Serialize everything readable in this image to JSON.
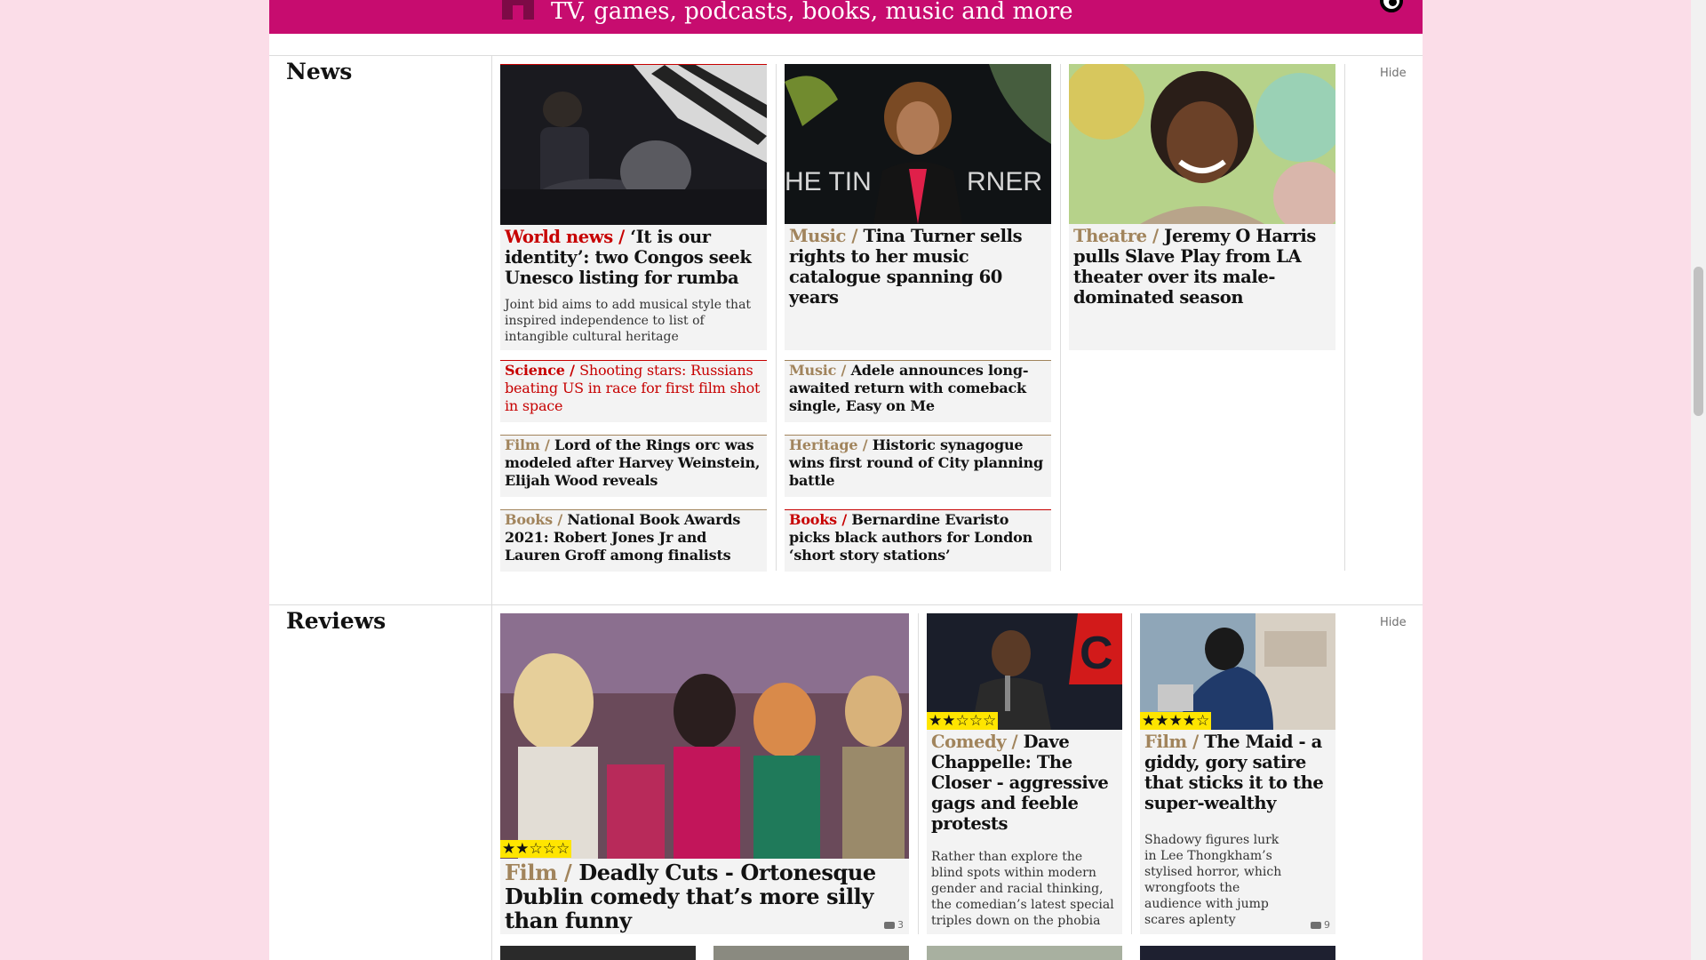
{
  "banner": {
    "text": "TV, games, podcasts, books, music and more",
    "icon": "guardian-icon",
    "logo": "guardian-logo-icon"
  },
  "news": {
    "title": "News",
    "hide_label": "Hide",
    "featured": [
      {
        "kicker": "World news /",
        "headline": "‘It is our identity’: two Congos seek Unesco listing for rumba",
        "standfirst": "Joint bid aims to add musical style that inspired independence to list of intangible cultural heritage",
        "image": "rumba-musicians-photo"
      },
      {
        "kicker": "Music /",
        "headline": "Tina Turner sells rights to her music catalogue spanning 60 years",
        "image": "tina-turner-photo"
      },
      {
        "kicker": "Theatre /",
        "headline": "Jeremy O Harris pulls Slave Play from LA theater over its male-dominated season",
        "image": "jeremy-o-harris-photo"
      }
    ],
    "small": [
      {
        "kicker": "Science /",
        "headline": "Shooting stars: Russians beating US in race for first film shot in space"
      },
      {
        "kicker": "Music /",
        "headline": "Adele announces long-awaited return with comeback single, Easy on Me"
      },
      {
        "kicker": "Film /",
        "headline": "Lord of the Rings orc was modeled after Harvey Weinstein, Elijah Wood reveals"
      },
      {
        "kicker": "Heritage /",
        "headline": "Historic synagogue wins first round of City planning battle"
      },
      {
        "kicker": "Books /",
        "headline": "National Book Awards 2021: Robert Jones Jr and Lauren Groff among finalists"
      },
      {
        "kicker": "Books /",
        "headline": "Bernardine Evaristo picks black authors for London ‘short story stations’"
      }
    ]
  },
  "reviews": {
    "title": "Reviews",
    "hide_label": "Hide",
    "items": [
      {
        "kicker": "Film /",
        "headline": "Deadly Cuts - Ortonesque Dublin comedy that’s more silly than funny",
        "stars": "★★☆☆☆",
        "rating": 2,
        "comments": "3",
        "image": "deadly-cuts-photo"
      },
      {
        "kicker": "Comedy /",
        "headline": "Dave Chappelle: The Closer - aggressive gags and feeble protests",
        "standfirst": "Rather than explore the blind spots within modern gender and racial thinking, the comedian’s latest special triples down on the phobia",
        "stars": "★★☆☆☆",
        "rating": 2,
        "image": "dave-chappelle-photo"
      },
      {
        "kicker": "Film /",
        "headline": "The Maid - a giddy, gory satire that sticks it to the super-wealthy",
        "standfirst": "Shadowy figures lurk in Lee Thongkham’s stylised horror, which wrongfoots the audience with jump scares aplenty",
        "stars": "★★★★☆",
        "rating": 4,
        "comments": "9",
        "image": "the-maid-photo"
      }
    ]
  },
  "colors": {
    "news": "#c70000",
    "culture": "#a1845c",
    "banner": "#c70c6f",
    "star_bg": "#ffe500",
    "page_bg": "#fbdde8"
  }
}
